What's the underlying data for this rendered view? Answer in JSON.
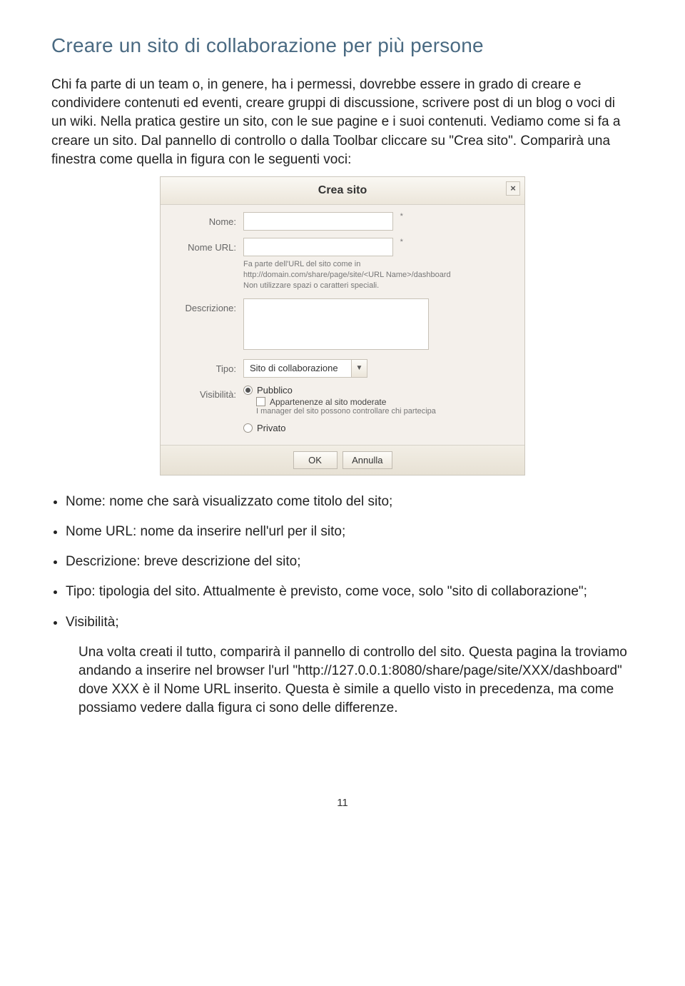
{
  "heading": "Creare un sito di collaborazione per più persone",
  "intro": "Chi fa parte di un team o, in genere, ha i permessi, dovrebbe essere in grado di creare e condividere contenuti ed eventi, creare gruppi di discussione, scrivere post di un blog o voci di un wiki. Nella pratica gestire un sito, con le sue pagine e i suoi contenuti. Vediamo come si fa a creare un sito. Dal pannello di controllo o dalla Toolbar cliccare su \"Crea sito\". Comparirà una finestra come quella in figura con le seguenti voci:",
  "dialog": {
    "title": "Crea sito",
    "close": "×",
    "fields": {
      "name_label": "Nome:",
      "name_req": "*",
      "url_label": "Nome URL:",
      "url_req": "*",
      "url_help1": "Fa parte dell'URL del sito come in",
      "url_help2": "http://domain.com/share/page/site/<URL Name>/dashboard",
      "url_help3": "Non utilizzare spazi o caratteri speciali.",
      "desc_label": "Descrizione:",
      "type_label": "Tipo:",
      "type_value": "Sito di collaborazione",
      "vis_label": "Visibilità:",
      "vis_public": "Pubblico",
      "vis_moderate": "Appartenenze al sito moderate",
      "vis_moderate_note": "I manager del sito possono controllare chi partecipa",
      "vis_private": "Privato"
    },
    "buttons": {
      "ok": "OK",
      "cancel": "Annulla"
    }
  },
  "bullets": [
    "Nome: nome che sarà visualizzato come titolo del sito;",
    "Nome URL: nome da inserire nell'url per il sito;",
    "Descrizione: breve descrizione del sito;",
    "Tipo: tipologia del sito. Attualmente è previsto, come voce, solo \"sito di collaborazione\";",
    "Visibilità;"
  ],
  "after_list": "Una volta creati il tutto, comparirà il pannello di controllo del sito. Questa pagina la troviamo andando a inserire nel browser l'url \"http://127.0.0.1:8080/share/page/site/XXX/dashboard\" dove XXX è il Nome URL inserito. Questa è simile a quello visto in precedenza, ma come possiamo vedere dalla figura ci sono delle differenze.",
  "page_number": "11"
}
